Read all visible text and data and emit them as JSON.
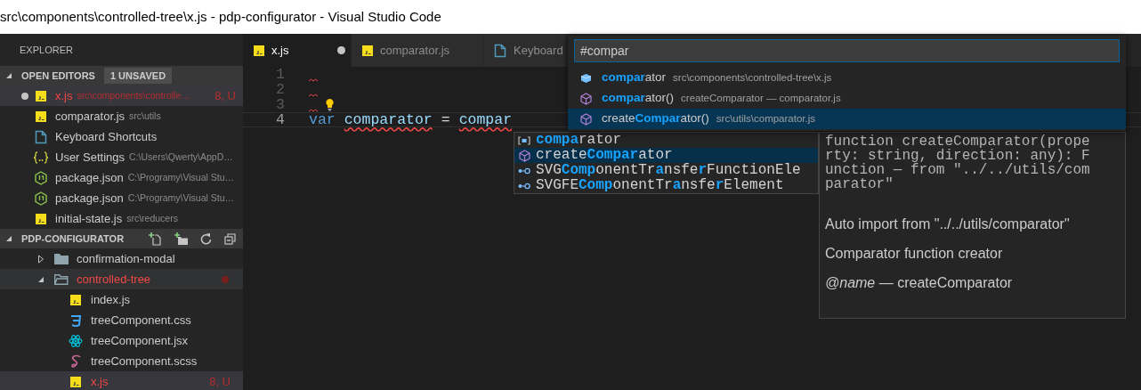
{
  "window": {
    "title": "src\\components\\controlled-tree\\x.js - pdp-configurator - Visual Studio Code"
  },
  "sidebar": {
    "title": "EXPLORER",
    "open_editors": {
      "title": "OPEN EDITORS",
      "expanded": true,
      "badge": "1 UNSAVED",
      "items": [
        {
          "name": "x.js",
          "path": "src\\components\\controlle…",
          "badge": "8, U",
          "kind": "js",
          "modified": true,
          "error": true,
          "selected": true
        },
        {
          "name": "comparator.js",
          "path": "src\\utils",
          "kind": "js",
          "modified": false,
          "error": false,
          "selected": false
        },
        {
          "name": "Keyboard Shortcuts",
          "kind": "document",
          "modified": false,
          "error": false,
          "selected": false
        },
        {
          "name": "User Settings",
          "path": "C:\\Users\\Qwerty\\AppD…",
          "kind": "settings",
          "modified": false,
          "error": false,
          "selected": false
        },
        {
          "name": "package.json",
          "path": "C:\\Programy\\Visual Stu…",
          "kind": "node",
          "modified": false,
          "error": false,
          "selected": false
        },
        {
          "name": "package.json",
          "path": "C:\\Programy\\Visual Stu…",
          "kind": "node",
          "modified": false,
          "error": false,
          "selected": false
        },
        {
          "name": "initial-state.js",
          "path": "src\\reducers",
          "kind": "js",
          "modified": false,
          "error": false,
          "selected": false
        }
      ]
    },
    "project": {
      "title": "PDP-CONFIGURATOR",
      "expanded": true,
      "items": [
        {
          "name": "confirmation-modal",
          "kind": "folder",
          "expanded": false,
          "error": false,
          "selected": false,
          "hovered": false
        },
        {
          "name": "controlled-tree",
          "kind": "folder",
          "expanded": true,
          "error": true,
          "selected": false,
          "hovered": true,
          "children": [
            {
              "name": "index.js",
              "kind": "js",
              "error": false,
              "selected": false,
              "hovered": false
            },
            {
              "name": "treeComponent.css",
              "kind": "css",
              "error": false,
              "selected": false,
              "hovered": false
            },
            {
              "name": "treeComponent.jsx",
              "kind": "react",
              "error": false,
              "selected": false,
              "hovered": false
            },
            {
              "name": "treeComponent.scss",
              "kind": "sass",
              "error": false,
              "selected": false,
              "hovered": false
            },
            {
              "name": "x.js",
              "kind": "js",
              "badge": "8, U",
              "error": true,
              "selected": true,
              "hovered": false
            }
          ]
        }
      ]
    }
  },
  "tabs": [
    {
      "label": "x.js",
      "kind": "js",
      "selected": true,
      "modified": true
    },
    {
      "label": "comparator.js",
      "kind": "js",
      "selected": false,
      "modified": false
    },
    {
      "label": "Keyboard",
      "kind": "document",
      "selected": false,
      "modified": false
    }
  ],
  "editor": {
    "lines": [
      {
        "number": "1",
        "error": true,
        "lightbulb": false,
        "current": false
      },
      {
        "number": "2",
        "error": true,
        "lightbulb": false,
        "current": false
      },
      {
        "number": "3",
        "error": true,
        "lightbulb": true,
        "current": false
      },
      {
        "number": "4",
        "error": false,
        "lightbulb": false,
        "current": true,
        "tokens": [
          {
            "text": "var",
            "kind": "keyword",
            "error": false
          },
          {
            "text": "comparator",
            "kind": "variable",
            "error": true
          },
          {
            "text": "=",
            "kind": "operator",
            "error": false
          },
          {
            "text": "compar",
            "kind": "variable",
            "error": true
          }
        ]
      }
    ]
  },
  "quick_open": {
    "value": "#compar",
    "items": [
      {
        "kind": "variable",
        "parts": [
          {
            "text": "compar",
            "match": true
          },
          {
            "text": "ator",
            "match": false
          }
        ],
        "detail": "src\\components\\controlled-tree\\x.js",
        "selected": false
      },
      {
        "kind": "method",
        "parts": [
          {
            "text": "compar",
            "match": true
          },
          {
            "text": "ator()",
            "match": false
          }
        ],
        "detail": "createComparator — comparator.js",
        "selected": false
      },
      {
        "kind": "method",
        "parts": [
          {
            "text": "create",
            "match": false
          },
          {
            "text": "Compar",
            "match": true
          },
          {
            "text": "ator()",
            "match": false
          }
        ],
        "detail": "src\\utils\\comparator.js",
        "selected": true
      }
    ]
  },
  "suggestions": {
    "items": [
      {
        "kind": "variable",
        "parts": [
          {
            "text": "compa",
            "match": true
          },
          {
            "text": "rator",
            "match": false
          }
        ],
        "selected": false
      },
      {
        "kind": "method",
        "parts": [
          {
            "text": "create",
            "match": false
          },
          {
            "text": "Compar",
            "match": true
          },
          {
            "text": "ator",
            "match": false
          }
        ],
        "selected": true
      },
      {
        "kind": "interface",
        "parts": [
          {
            "text": "SVG",
            "match": false
          },
          {
            "text": "Comp",
            "match": true
          },
          {
            "text": "onentTr",
            "match": false
          },
          {
            "text": "a",
            "match": true
          },
          {
            "text": "nsfe",
            "match": false
          },
          {
            "text": "r",
            "match": true
          },
          {
            "text": "FunctionEle",
            "match": false
          }
        ],
        "selected": false
      },
      {
        "kind": "interface",
        "parts": [
          {
            "text": "SVGFE",
            "match": false
          },
          {
            "text": "Comp",
            "match": true
          },
          {
            "text": "onentTr",
            "match": false
          },
          {
            "text": "a",
            "match": true
          },
          {
            "text": "nsfe",
            "match": false
          },
          {
            "text": "r",
            "match": true
          },
          {
            "text": "Element",
            "match": false
          }
        ],
        "selected": false
      }
    ]
  },
  "details": {
    "signature": "function createComparator(property: string, direction: any): Function — from \"../../utils/comparator\"",
    "paragraphs": [
      "Auto import from \"../../utils/comparator\"",
      "Comparator function creator",
      "*@name* — createComparator"
    ]
  }
}
